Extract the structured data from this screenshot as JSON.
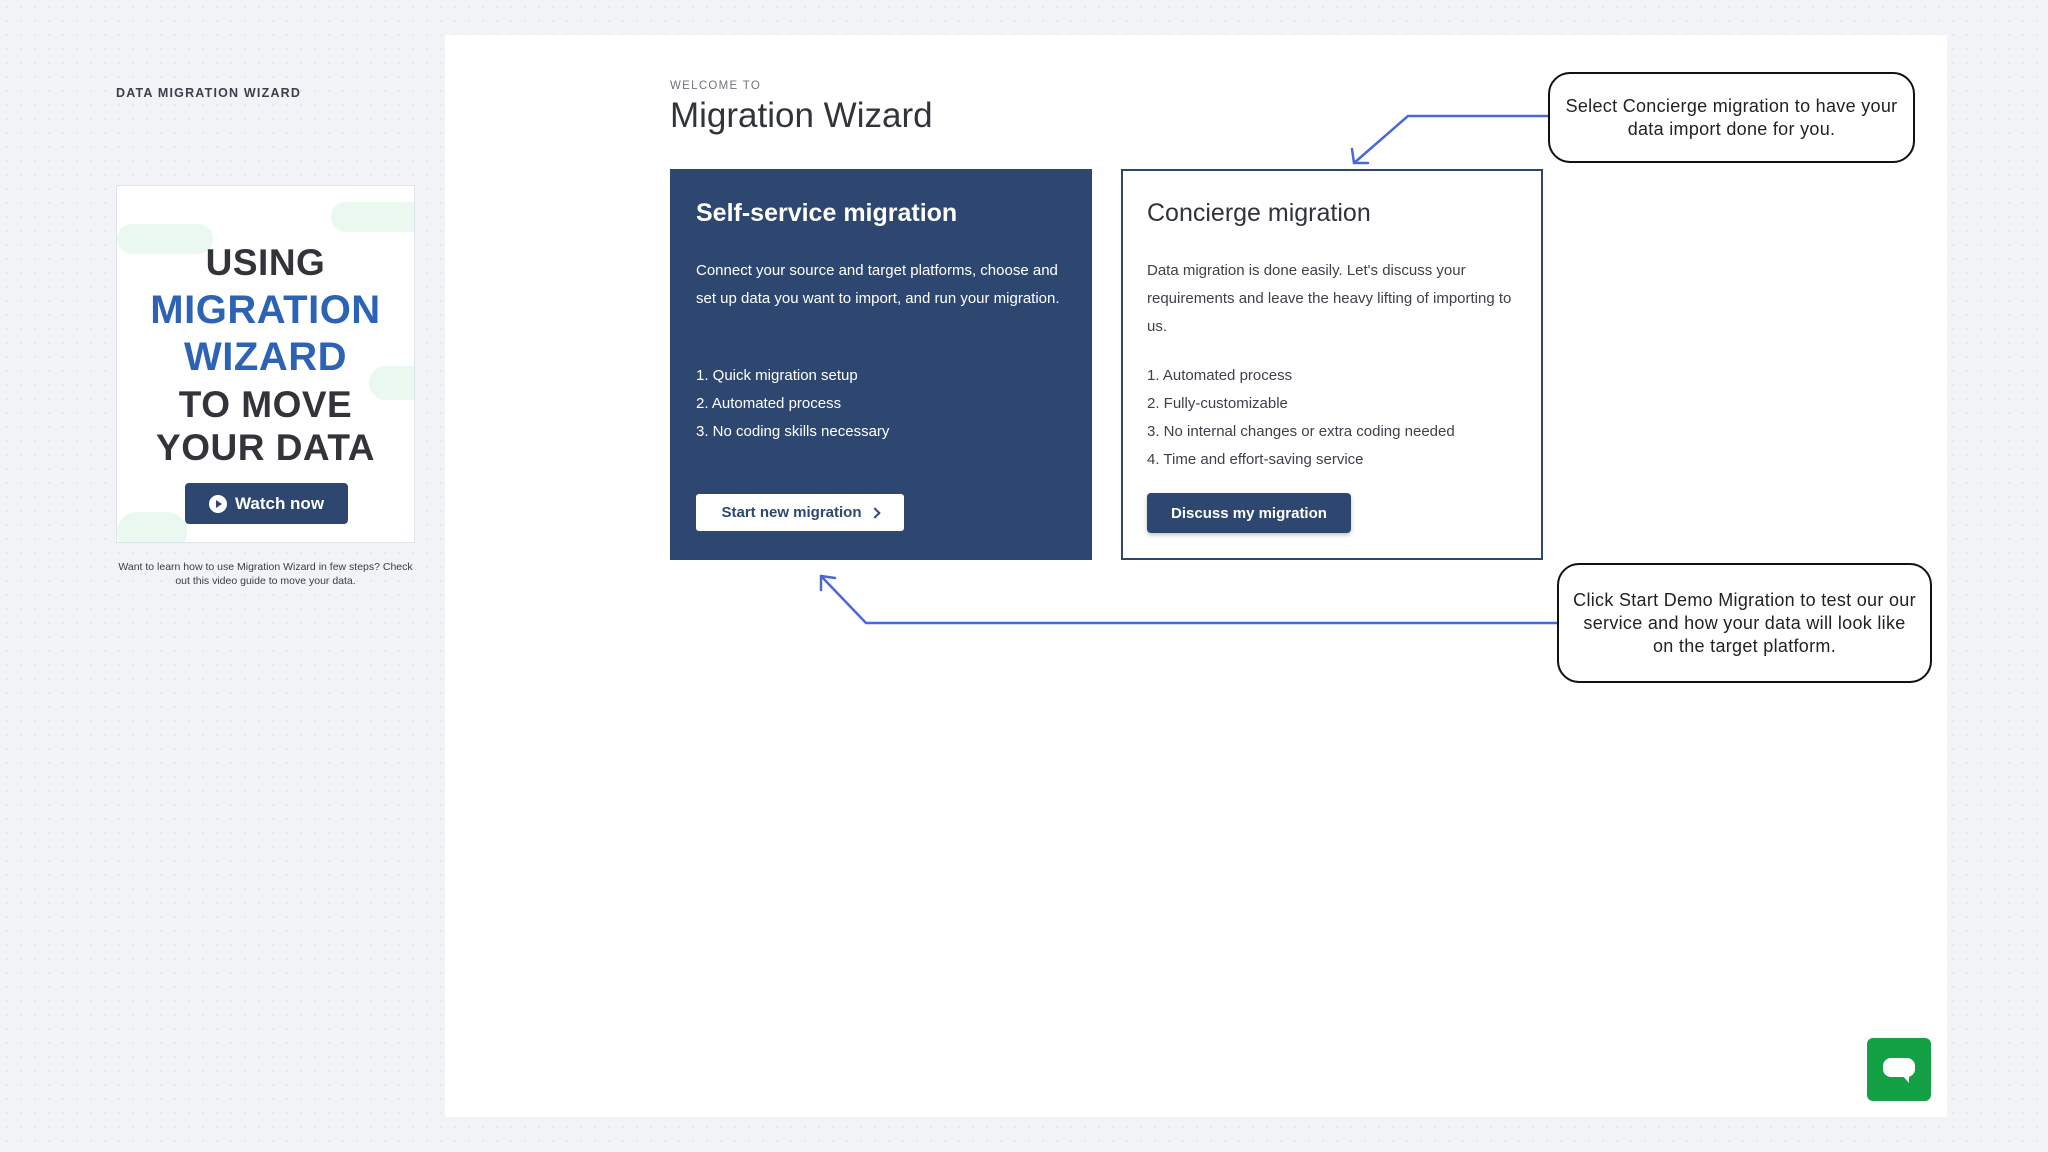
{
  "sidebar": {
    "title": "DATA MIGRATION WIZARD",
    "video": {
      "lines": [
        "USING",
        "MIGRATION",
        "WIZARD",
        "TO MOVE",
        "YOUR DATA"
      ],
      "button_label": "Watch now",
      "caption": "Want to learn how to use Migration Wizard in few steps? Check out this video guide to move your data."
    }
  },
  "header": {
    "welcome": "WELCOME TO",
    "title": "Migration Wizard"
  },
  "cards": {
    "self_service": {
      "title": "Self-service migration",
      "description": "Connect your source and target platforms, choose and set up data you want to import, and run your migration.",
      "items": [
        "1. Quick migration setup",
        "2. Automated process",
        "3. No coding skills necessary"
      ],
      "button_label": "Start new migration"
    },
    "concierge": {
      "title": "Concierge migration",
      "description": "Data migration is done easily. Let's discuss your requirements and leave the heavy lifting of importing to us.",
      "items": [
        "1. Automated process",
        "2. Fully-customizable",
        "3. No internal changes or extra coding needed",
        "4. Time and effort-saving service"
      ],
      "button_label": "Discuss my migration"
    }
  },
  "callouts": {
    "concierge": "Select Concierge migration to have your data import done for you.",
    "demo": "Click Start Demo Migration to test our our service and how your data will look like on the target platform."
  },
  "colors": {
    "navy": "#2e4770",
    "accent_blue": "#2d63b5",
    "arrow_blue": "#4a68d8",
    "chat_green": "#14a146"
  },
  "icons": {
    "watch": "play-icon",
    "start": "chevron-right-icon",
    "chat": "chat-bubble-icon"
  }
}
